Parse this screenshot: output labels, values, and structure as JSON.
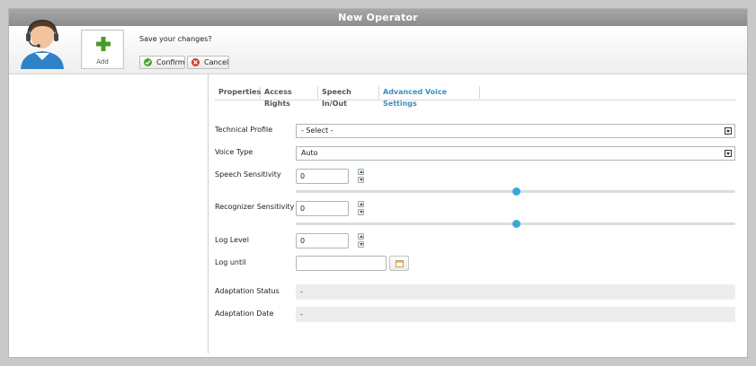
{
  "window": {
    "title": "New Operator"
  },
  "toolbar": {
    "add_label": "Add",
    "prompt": "Save your changes?",
    "confirm_label": "Confirm",
    "cancel_label": "Cancel"
  },
  "tabs": [
    {
      "label": "Properties",
      "active": false
    },
    {
      "label": "Access Rights",
      "active": false
    },
    {
      "label": "Speech In/Out",
      "active": false
    },
    {
      "label": "Advanced Voice Settings",
      "active": true
    }
  ],
  "form": {
    "technical_profile": {
      "label": "Technical Profile",
      "value": "- Select -"
    },
    "voice_type": {
      "label": "Voice Type",
      "value": "Auto"
    },
    "speech_sensitivity": {
      "label": "Speech Sensitivity",
      "value": "0",
      "slider_fraction": 0.5
    },
    "recognizer_sensitivity": {
      "label": "Recognizer Sensitivity",
      "value": "0",
      "slider_fraction": 0.5
    },
    "log_level": {
      "label": "Log Level",
      "value": "0"
    },
    "log_until": {
      "label": "Log until",
      "value": ""
    },
    "adaptation_status": {
      "label": "Adaptation Status",
      "value": "-"
    },
    "adaptation_date": {
      "label": "Adaptation Date",
      "value": "-"
    }
  },
  "colors": {
    "accent": "#3c8fc3",
    "slider_knob": "#3aa8d8",
    "confirm_icon": "#4aa329",
    "cancel_icon": "#d23a2b",
    "add_icon": "#4a9a26"
  },
  "icons": {
    "avatar": "operator-headset-avatar",
    "add": "plus-icon",
    "confirm": "check-circle-icon",
    "cancel": "x-circle-icon",
    "calendar": "calendar-icon"
  }
}
